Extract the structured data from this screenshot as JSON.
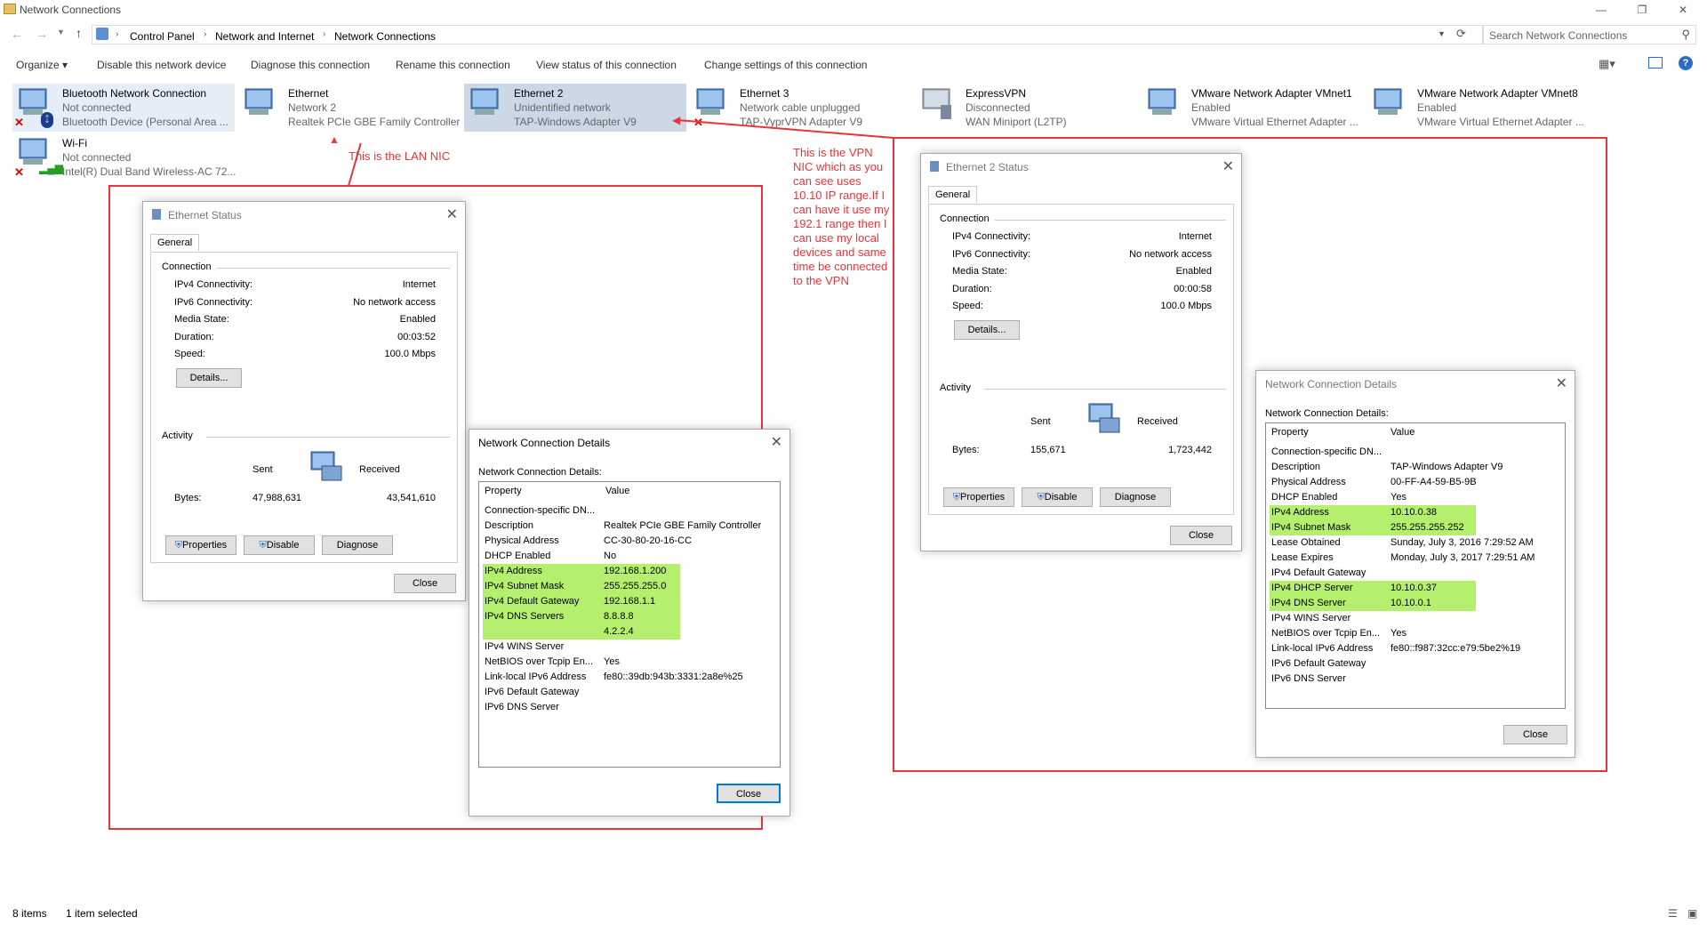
{
  "window": {
    "title": "Network Connections"
  },
  "breadcrumb": [
    "Control Panel",
    "Network and Internet",
    "Network Connections"
  ],
  "search": {
    "placeholder": "Search Network Connections"
  },
  "toolbar": {
    "organize": "Organize",
    "items": [
      "Disable this network device",
      "Diagnose this connection",
      "Rename this connection",
      "View status of this connection",
      "Change settings of this connection"
    ]
  },
  "connections": [
    {
      "name": "Bluetooth Network Connection",
      "status": "Not connected",
      "device": "Bluetooth Device (Personal Area ..."
    },
    {
      "name": "Ethernet",
      "status": "Network  2",
      "device": "Realtek PCIe GBE Family Controller"
    },
    {
      "name": "Ethernet 2",
      "status": "Unidentified network",
      "device": "TAP-Windows Adapter V9"
    },
    {
      "name": "Ethernet 3",
      "status": "Network cable unplugged",
      "device": "TAP-VyprVPN Adapter V9"
    },
    {
      "name": "ExpressVPN",
      "status": "Disconnected",
      "device": "WAN Miniport (L2TP)"
    },
    {
      "name": "VMware Network Adapter VMnet1",
      "status": "Enabled",
      "device": "VMware Virtual Ethernet Adapter ..."
    },
    {
      "name": "VMware Network Adapter VMnet8",
      "status": "Enabled",
      "device": "VMware Virtual Ethernet Adapter ..."
    },
    {
      "name": "Wi-Fi",
      "status": "Not connected",
      "device": "Intel(R) Dual Band Wireless-AC 72..."
    }
  ],
  "annotations": {
    "lan": "This is the LAN NIC",
    "vpn": "This is the VPN NIC which as you can see uses 10.10 IP range.If I can have it use my 192.1 range then I can use my local devices and same time be connected to the VPN"
  },
  "eth_status": {
    "title": "Ethernet Status",
    "tab": "General",
    "connection": "Connection",
    "ipv4_label": "IPv4 Connectivity:",
    "ipv4": "Internet",
    "ipv6_label": "IPv6 Connectivity:",
    "ipv6": "No network access",
    "media_label": "Media State:",
    "media": "Enabled",
    "duration_label": "Duration:",
    "duration": "00:03:52",
    "speed_label": "Speed:",
    "speed": "100.0 Mbps",
    "details": "Details...",
    "activity": "Activity",
    "sent": "Sent",
    "received": "Received",
    "bytes_label": "Bytes:",
    "bytes_sent": "47,988,631",
    "bytes_recv": "43,541,610",
    "properties": "Properties",
    "disable": "Disable",
    "diagnose": "Diagnose",
    "close": "Close"
  },
  "eth2_status": {
    "title": "Ethernet 2 Status",
    "tab": "General",
    "connection": "Connection",
    "ipv4_label": "IPv4 Connectivity:",
    "ipv4": "Internet",
    "ipv6_label": "IPv6 Connectivity:",
    "ipv6": "No network access",
    "media_label": "Media State:",
    "media": "Enabled",
    "duration_label": "Duration:",
    "duration": "00:00:58",
    "speed_label": "Speed:",
    "speed": "100.0 Mbps",
    "details": "Details...",
    "activity": "Activity",
    "sent": "Sent",
    "received": "Received",
    "bytes_label": "Bytes:",
    "bytes_sent": "155,671",
    "bytes_recv": "1,723,442",
    "properties": "Properties",
    "disable": "Disable",
    "diagnose": "Diagnose",
    "close": "Close"
  },
  "eth_details": {
    "title": "Network Connection Details",
    "label": "Network Connection Details:",
    "col_property": "Property",
    "col_value": "Value",
    "close": "Close",
    "rows": [
      [
        "Connection-specific DN...",
        ""
      ],
      [
        "Description",
        "Realtek PCIe GBE Family Controller"
      ],
      [
        "Physical Address",
        "CC-30-80-20-16-CC"
      ],
      [
        "DHCP Enabled",
        "No"
      ],
      [
        "IPv4 Address",
        "192.168.1.200"
      ],
      [
        "IPv4 Subnet Mask",
        "255.255.255.0"
      ],
      [
        "IPv4 Default Gateway",
        "192.168.1.1"
      ],
      [
        "IPv4 DNS Servers",
        "8.8.8.8"
      ],
      [
        "",
        "4.2.2.4"
      ],
      [
        "IPv4 WINS Server",
        ""
      ],
      [
        "NetBIOS over Tcpip En...",
        "Yes"
      ],
      [
        "Link-local IPv6 Address",
        "fe80::39db:943b:3331:2a8e%25"
      ],
      [
        "IPv6 Default Gateway",
        ""
      ],
      [
        "IPv6 DNS Server",
        ""
      ]
    ]
  },
  "eth2_details": {
    "title": "Network Connection Details",
    "label": "Network Connection Details:",
    "col_property": "Property",
    "col_value": "Value",
    "close": "Close",
    "rows": [
      [
        "Connection-specific DN...",
        ""
      ],
      [
        "Description",
        "TAP-Windows Adapter V9"
      ],
      [
        "Physical Address",
        "00-FF-A4-59-B5-9B"
      ],
      [
        "DHCP Enabled",
        "Yes"
      ],
      [
        "IPv4 Address",
        "10.10.0.38"
      ],
      [
        "IPv4 Subnet Mask",
        "255.255.255.252"
      ],
      [
        "Lease Obtained",
        "Sunday, July 3, 2016 7:29:52 AM"
      ],
      [
        "Lease Expires",
        "Monday, July 3, 2017 7:29:51 AM"
      ],
      [
        "IPv4 Default Gateway",
        ""
      ],
      [
        "IPv4 DHCP Server",
        "10.10.0.37"
      ],
      [
        "IPv4 DNS Server",
        "10.10.0.1"
      ],
      [
        "IPv4 WINS Server",
        ""
      ],
      [
        "NetBIOS over Tcpip En...",
        "Yes"
      ],
      [
        "Link-local IPv6 Address",
        "fe80::f987:32cc:e79:5be2%19"
      ],
      [
        "IPv6 Default Gateway",
        ""
      ],
      [
        "IPv6 DNS Server",
        ""
      ]
    ]
  },
  "statusbar": {
    "items": "8 items",
    "selected": "1 item selected"
  },
  "colors": {
    "highlight": "#b4f06e",
    "annotation": "#e8353b",
    "selection": "#ccd8e6"
  }
}
